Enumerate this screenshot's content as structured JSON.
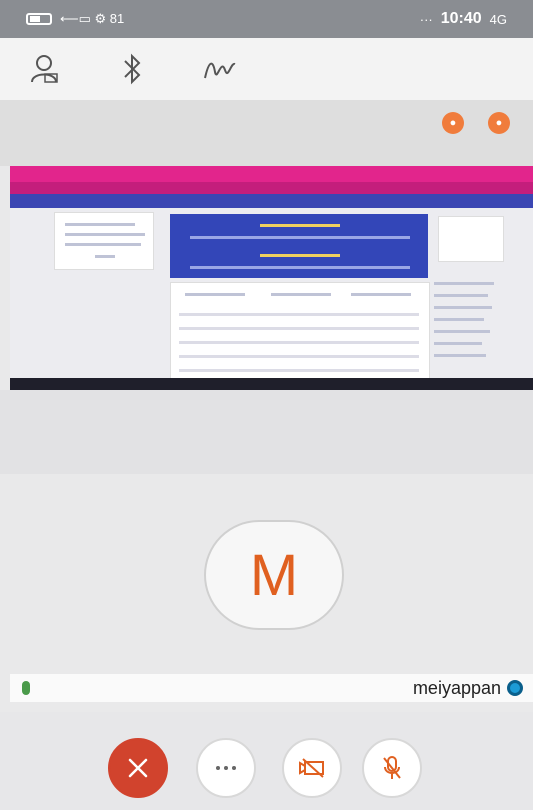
{
  "status_bar": {
    "time": "10:40",
    "left_symbols": "⟵▭ ⚙ 81",
    "right_signal": "4G",
    "dots": "···"
  },
  "toolbar": {
    "items": [
      "people",
      "bluetooth",
      "signal"
    ]
  },
  "share": {
    "description": ""
  },
  "participant": {
    "initial": "M",
    "name": "meiyappan"
  },
  "controls": {
    "labels": [
      "end-call",
      "more",
      "camera-off",
      "mic-off"
    ]
  },
  "colors": {
    "accent": "#e06020",
    "end_call": "#d1432d",
    "magenta": "#e2258c",
    "teams_blue": "#1c9bd6"
  }
}
